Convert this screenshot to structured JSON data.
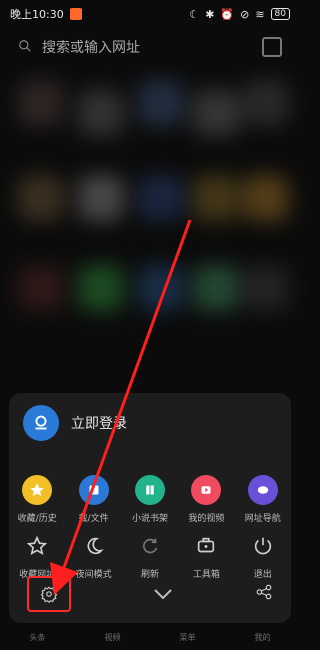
{
  "status": {
    "time": "晚上10:30",
    "battery": "80"
  },
  "search": {
    "placeholder": "搜索或输入网址"
  },
  "login": {
    "label": "立即登录"
  },
  "menu": {
    "row1": [
      {
        "label": "收藏/历史",
        "color": "#f2c026",
        "icon": "star-icon"
      },
      {
        "label": "载/文件",
        "color": "#2b78d6",
        "icon": "download-icon"
      },
      {
        "label": "小说书架",
        "color": "#22b38c",
        "icon": "book-icon"
      },
      {
        "label": "我的视频",
        "color": "#f14b5f",
        "icon": "video-icon"
      },
      {
        "label": "网址导航",
        "color": "#6a4fd8",
        "icon": "navigation-icon"
      }
    ],
    "row2": [
      {
        "label": "收藏网址",
        "icon": "star-add-icon"
      },
      {
        "label": "夜间模式",
        "icon": "moon-icon"
      },
      {
        "label": "刷新",
        "icon": "refresh-icon"
      },
      {
        "label": "工具箱",
        "icon": "toolbox-icon"
      },
      {
        "label": "退出",
        "icon": "power-icon"
      }
    ]
  },
  "tabbar": {
    "items": [
      "头条",
      "视频",
      "菜单",
      "我的"
    ]
  },
  "colors": {
    "highlight": "#ff2b2b",
    "sheet": "#1d1d1d"
  }
}
